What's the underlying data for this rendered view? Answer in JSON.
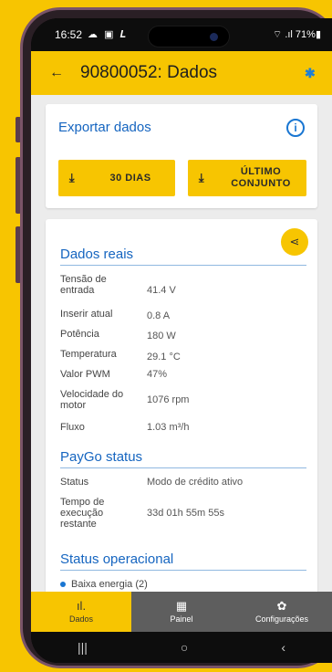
{
  "status_bar": {
    "time": "16:52",
    "left_icons": "☁ ▣ 𝑳",
    "right": "⌔ .ıl 71%▮"
  },
  "app_bar": {
    "back": "←",
    "title": "90800052: Dados",
    "bluetooth": "✱"
  },
  "export": {
    "title": "Exportar dados",
    "info": "i",
    "btn_30": "30 DIAS",
    "btn_last": "ÚLTIMO CONJUNTO",
    "download_glyph": "⤓"
  },
  "share_glyph": "⋖",
  "dados_reais": {
    "title": "Dados reais",
    "rows": [
      {
        "k": "Tensão de entrada",
        "v": "41.4 V"
      },
      {
        "k": "Inserir atual",
        "v": "0.8 A"
      },
      {
        "k": "Potência",
        "v": "180 W"
      },
      {
        "k": "Temperatura",
        "v": "29.1 °C"
      },
      {
        "k": "Valor PWM",
        "v": "47%"
      },
      {
        "k": "Velocidade do motor",
        "v": "1076 rpm"
      },
      {
        "k": "Fluxo",
        "v": "1.03 m³/h"
      }
    ]
  },
  "paygo": {
    "title": "PayGo status",
    "rows": [
      {
        "k": "Status",
        "v": "Modo de crédito ativo"
      },
      {
        "k": "Tempo de execução restante",
        "v": "33d 01h 55m 55s"
      }
    ]
  },
  "status_operacional": {
    "title": "Status operacional",
    "items": [
      "Baixa energia (2)"
    ]
  },
  "bottom_nav": [
    {
      "label": "Dados",
      "icon": "ıl."
    },
    {
      "label": "Painel",
      "icon": "▦"
    },
    {
      "label": "Configurações",
      "icon": "✿"
    }
  ],
  "sys_nav": {
    "recent": "|||",
    "home": "○",
    "back": "‹"
  },
  "colors": {
    "accent": "#f7c501",
    "link": "#1565c0"
  }
}
